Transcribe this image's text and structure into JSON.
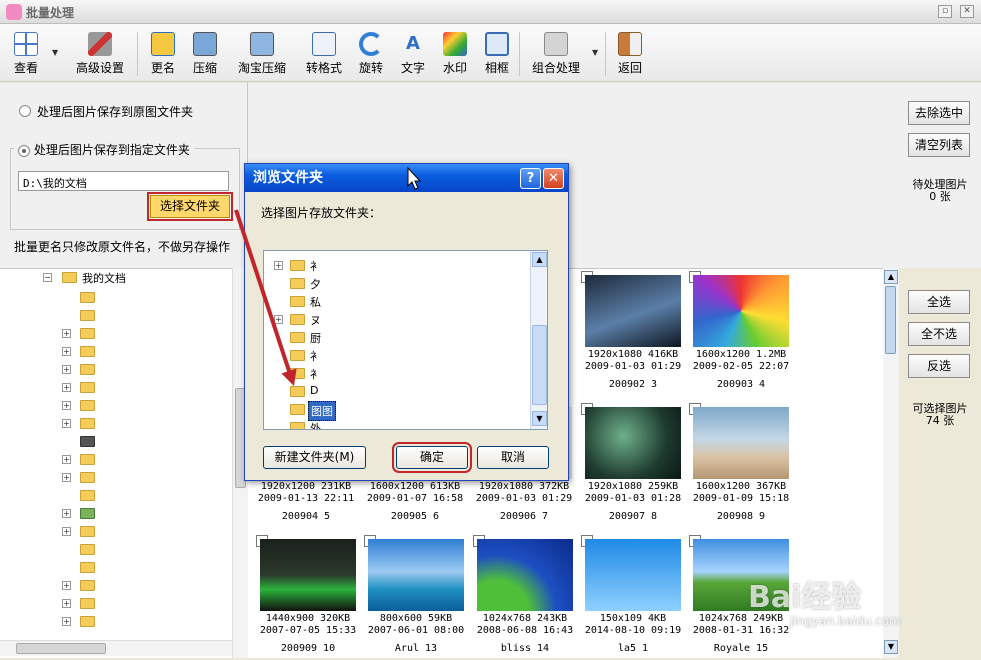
{
  "window": {
    "title": "批量处理"
  },
  "toolbar": {
    "items": [
      {
        "label": "查看",
        "icon": "grid-view-icon"
      },
      {
        "label": "高级设置",
        "icon": "tools-icon"
      },
      {
        "label": "更名",
        "icon": "rename-icon"
      },
      {
        "label": "压缩",
        "icon": "compress-icon"
      },
      {
        "label": "淘宝压缩",
        "icon": "taobao-compress-icon"
      },
      {
        "label": "转格式",
        "icon": "convert-format-icon"
      },
      {
        "label": "旋转",
        "icon": "rotate-icon"
      },
      {
        "label": "文字",
        "icon": "text-icon"
      },
      {
        "label": "水印",
        "icon": "watermark-icon"
      },
      {
        "label": "相框",
        "icon": "frame-icon"
      },
      {
        "label": "组合处理",
        "icon": "combine-icon"
      },
      {
        "label": "返回",
        "icon": "back-icon"
      }
    ]
  },
  "save_options": {
    "option_original": "处理后图片保存到原图文件夹",
    "option_specified": "处理后图片保存到指定文件夹",
    "path": "D:\\我的文档",
    "choose_folder": "选择文件夹",
    "rename_note": "批量更名只修改原文件名，不做另存操作"
  },
  "right_panel": {
    "remove_selected": "去除选中",
    "clear_list": "清空列表",
    "pending_label": "待处理图片",
    "pending_count": "0 张",
    "select_all": "全选",
    "select_none": "全不选",
    "invert": "反选",
    "available_label": "可选择图片",
    "available_count": "74 张"
  },
  "tree": {
    "root": "我的文档"
  },
  "dialog": {
    "title": "浏览文件夹",
    "help": "?",
    "close": "✕",
    "prompt": "选择图片存放文件夹：",
    "folders": [
      "衤",
      "夕",
      "私",
      "ヌ",
      "厨",
      "衤",
      "衤",
      "D",
      "图图",
      "外"
    ],
    "new_folder": "新建文件夹(M)",
    "ok": "确定",
    "cancel": "取消"
  },
  "images": [
    {
      "info1": "1920x1080  416KB",
      "info2": "2009-01-03 01:29",
      "name": "200902 3"
    },
    {
      "info1": "1600x1200  1.2MB",
      "info2": "2009-02-05 22:07",
      "name": "200903 4"
    },
    {
      "info1": "1920x1200  231KB",
      "info2": "2009-01-13 22:11",
      "name": "200904 5"
    },
    {
      "info1": "1600x1200  613KB",
      "info2": "2009-01-07 16:58",
      "name": "200905 6"
    },
    {
      "info1": "1920x1080  372KB",
      "info2": "2009-01-03 01:29",
      "name": "200906 7"
    },
    {
      "info1": "1920x1080  259KB",
      "info2": "2009-01-03 01:28",
      "name": "200907 8"
    },
    {
      "info1": "1600x1200  367KB",
      "info2": "2009-01-09 15:18",
      "name": "200908 9"
    },
    {
      "info1": "1440x900  320KB",
      "info2": "2007-07-05 15:33",
      "name": "200909 10"
    },
    {
      "info1": "800x600  59KB",
      "info2": "2007-06-01 08:00",
      "name": "Arul 13"
    },
    {
      "info1": "1024x768  243KB",
      "info2": "2008-06-08 16:43",
      "name": "bliss 14"
    },
    {
      "info1": "150x109  4KB",
      "info2": "2014-08-10 09:19",
      "name": "la5 1"
    },
    {
      "info1": "1024x768  249KB",
      "info2": "2008-01-31 16:32",
      "name": "Royale 15"
    }
  ],
  "watermark": {
    "brand": "Bai经验",
    "url": "jingyan.baidu.com"
  },
  "colors": {
    "highlight": "#c0262c",
    "dialog_title": "#0a5ddf",
    "choose_btn": "#ffd76a"
  }
}
